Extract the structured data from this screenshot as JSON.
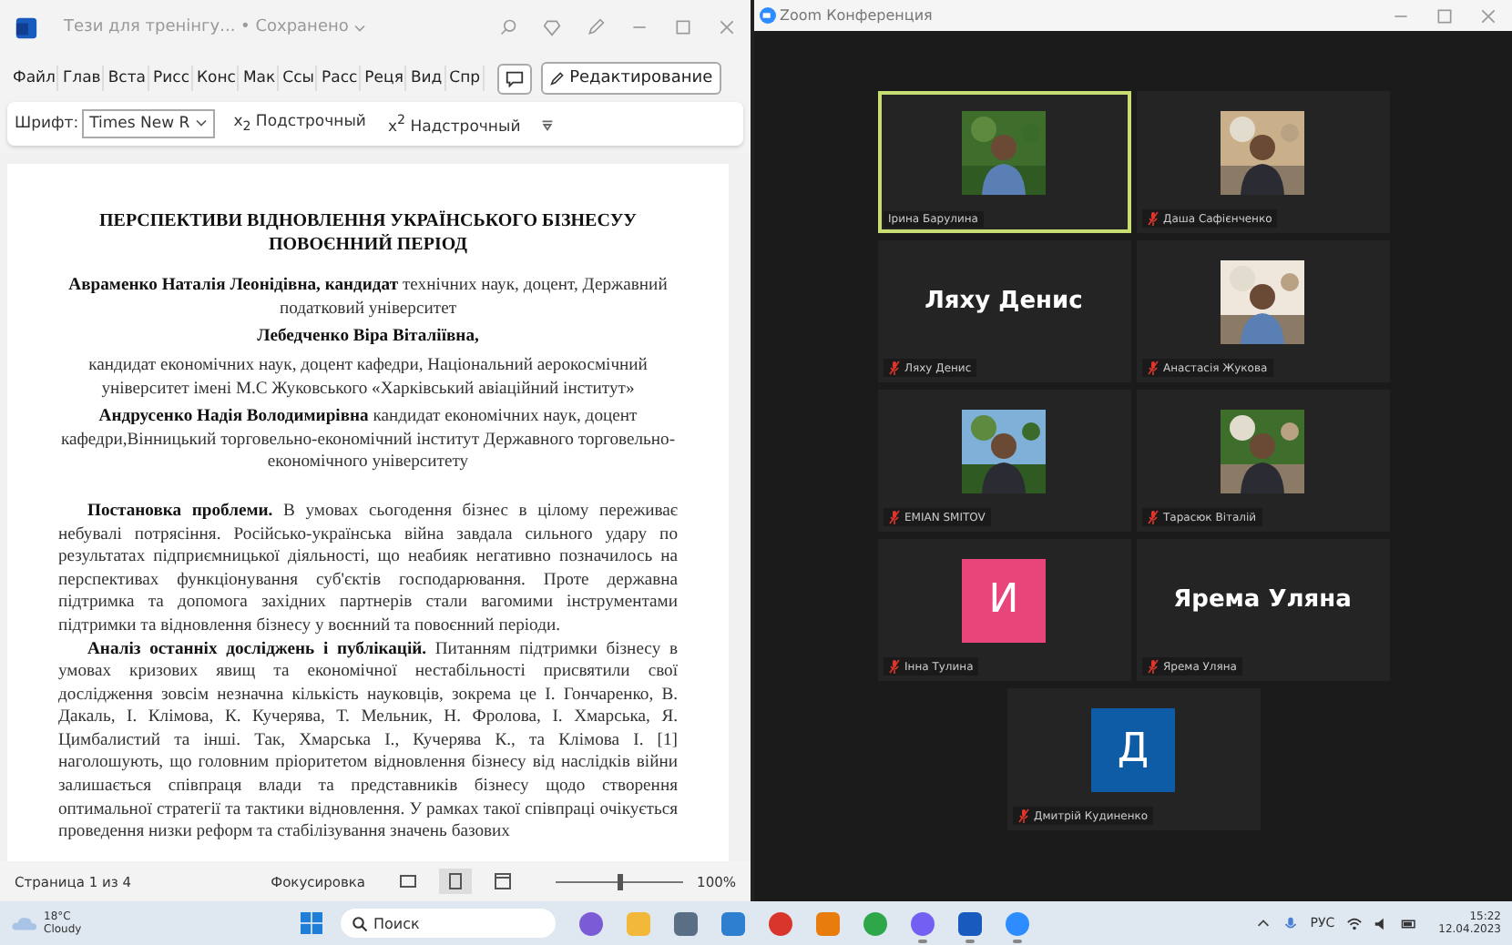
{
  "word": {
    "title": "Тези для тренінгу... • Сохранено",
    "ribbon_tabs": [
      {
        "label": "Файл",
        "selected": false
      },
      {
        "label": "Глав",
        "selected": false
      },
      {
        "label": "Вста",
        "selected": false
      },
      {
        "label": "Рисс",
        "selected": false
      },
      {
        "label": "Конс",
        "selected": false
      },
      {
        "label": "Мак",
        "selected": false
      },
      {
        "label": "Ссы",
        "selected": false
      },
      {
        "label": "Расс",
        "selected": false
      },
      {
        "label": "Реця",
        "selected": false
      },
      {
        "label": "Вид",
        "selected": false
      },
      {
        "label": "Спр",
        "selected": false
      }
    ],
    "edit_button": "Редактирование",
    "toolbar": {
      "font_label": "Шрифт:",
      "font_value": "Times New R",
      "subscript": "x$_{2}$ Подстрочный",
      "superscript": "x$^{2}$ Надстрочный"
    },
    "document": {
      "title": "ПЕРСПЕКТИВИ ВІДНОВЛЕННЯ УКРАЇНСЬКОГО БІЗНЕСУУ ПОВОЄННИЙ ПЕРІОД",
      "authors": [
        "**Авраменко Наталія Леонідівна, кандидат** технічних наук, доцент, Державний податковий університет",
        "**Лебедченко Віра Віталіївна,**",
        "кандидат економічних наук, доцент кафедри, Національний аерокосмічний університет імені М.С Жуковського «Харківський авіаційний інститут»",
        "**Андрусенко Надія Володимирівна** кандидат економічних наук, доцент кафедри,Вінницький торговельно-економічний інститут Державного торговельно-економічного університету"
      ],
      "paragraphs": [
        "**Постановка проблеми.** В умовах сьогодення бізнес в цілому переживає небувалі потрясіння. Російсько-українська війна завдала сильного удару по результатах підприємницької діяльності, що неабияк негативно позначилось на перспективах функціонування суб'єктів господарювання. Проте державна підтримка та допомога західних партнерів стали вагомими інструментами підтримки та відновлення бізнесу у воєнний та повоєнний періоди.",
        "**Аналіз останніх досліджень і публікацій.** Питанням підтримки бізнесу в умовах кризових явищ та економічної нестабільності присвятили свої дослідження зовсім незначна кількість науковців, зокрема це І. Гончаренко, В. Дакаль, І. Клімова, К. Кучерява, Т. Мельник, Н. Фролова, І. Хмарська, Я. Цимбалистий та інші. Так, Хмарська І., Кучерява К., та Клімова І. [1] наголошують, що головним пріоритетом відновлення бізнесу від наслідків війни залишається співпраця влади та представників бізнесу щодо створення оптимальної стратегії та тактики відновлення. У рамках такої співпраці очікується проведення низки реформ та стабілізування значень базових"
      ]
    },
    "status_bar": {
      "page": "Страница 1 из 4",
      "focus": "Фокусировка",
      "views": [
        {
          "kind": "read",
          "selected": false
        },
        {
          "kind": "print",
          "selected": true
        },
        {
          "kind": "web",
          "selected": false
        }
      ],
      "zoom": {
        "level": 0.5
      },
      "zoom_text": "100%"
    }
  },
  "zoom": {
    "title": "Zoom Конференция",
    "participants": [
      {
        "kind": "video",
        "name": "Ірина Барулина",
        "muted": false,
        "selected": true
      },
      {
        "kind": "video",
        "name": "Даша Сафієнченко",
        "muted": true,
        "selected": false
      },
      {
        "kind": "name",
        "display": "Ляху Денис",
        "name": "Ляху Денис",
        "muted": true,
        "selected": false
      },
      {
        "kind": "video",
        "name": "Анастасія Жукова",
        "muted": true,
        "selected": false
      },
      {
        "kind": "video",
        "name": "EMIAN SMITOV",
        "muted": true,
        "selected": false
      },
      {
        "kind": "video",
        "name": "Тарасюк Віталій",
        "muted": true,
        "selected": false
      },
      {
        "kind": "avatar",
        "initial": "И",
        "color": "#e8457a",
        "name": "Інна Тулина",
        "muted": true,
        "selected": false
      },
      {
        "kind": "name",
        "display": "Ярема Уляна",
        "name": "Ярема Уляна",
        "muted": true,
        "selected": false
      },
      {
        "kind": "avatar",
        "initial": "Д",
        "color": "#0e5ba6",
        "name": "Дмитрій Кудиненко",
        "muted": true,
        "selected": false
      }
    ]
  },
  "taskbar": {
    "weather": {
      "temp": "18°C",
      "condition": "Cloudy"
    },
    "search": {
      "placeholder": "Поиск"
    },
    "apps": [
      {
        "kind": "chat",
        "running": false
      },
      {
        "kind": "folder",
        "running": false
      },
      {
        "kind": "camera",
        "running": false
      },
      {
        "kind": "photos",
        "running": false
      },
      {
        "kind": "p",
        "running": false
      },
      {
        "kind": "blender",
        "running": false
      },
      {
        "kind": "chrome",
        "running": false
      },
      {
        "kind": "viber",
        "running": true
      },
      {
        "kind": "word",
        "running": true
      },
      {
        "kind": "zoom",
        "running": true
      }
    ],
    "language": "РУС",
    "time": "15:22",
    "date": "12.04.2023"
  }
}
